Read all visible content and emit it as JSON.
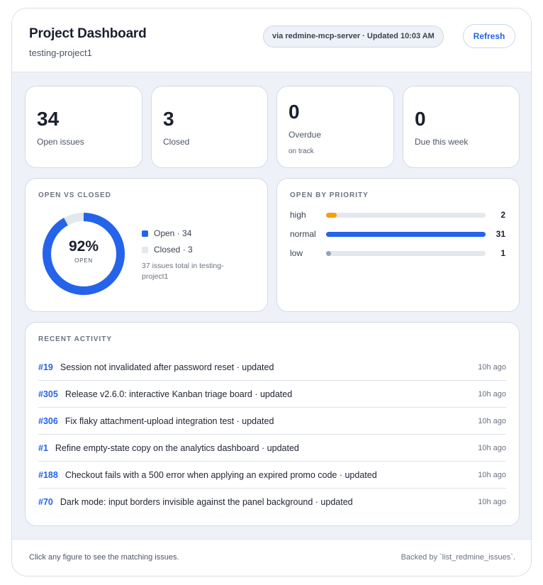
{
  "header": {
    "title": "Project Dashboard",
    "project": "testing-project1",
    "source_badge": "via redmine-mcp-server · Updated 10:03 AM",
    "refresh_label": "Refresh"
  },
  "stats": [
    {
      "value": "34",
      "label": "Open issues",
      "sub": ""
    },
    {
      "value": "3",
      "label": "Closed",
      "sub": ""
    },
    {
      "value": "0",
      "label": "Overdue",
      "sub": "on track"
    },
    {
      "value": "0",
      "label": "Due this week",
      "sub": ""
    }
  ],
  "open_vs_closed": {
    "section_label": "OPEN VS CLOSED",
    "percent": "92%",
    "caption": "OPEN",
    "open_fraction": 0.919,
    "legend": [
      {
        "label": "Open · 34",
        "color": "#2563eb"
      },
      {
        "label": "Closed · 3",
        "color": "#e3e7ee"
      }
    ],
    "note": "37 issues total in testing-project1"
  },
  "open_by_priority": {
    "section_label": "OPEN BY PRIORITY",
    "max": 31,
    "rows": [
      {
        "label": "high",
        "count": "2",
        "value": 2,
        "color": "#f59e0b"
      },
      {
        "label": "normal",
        "count": "31",
        "value": 31,
        "color": "#2563eb"
      },
      {
        "label": "low",
        "count": "1",
        "value": 1,
        "color": "#94a3b8"
      }
    ]
  },
  "recent_activity": {
    "section_label": "RECENT ACTIVITY",
    "items": [
      {
        "id": "#19",
        "text": "Session not invalidated after password reset · updated",
        "time": "10h ago"
      },
      {
        "id": "#305",
        "text": "Release v2.6.0: interactive Kanban triage board · updated",
        "time": "10h ago"
      },
      {
        "id": "#306",
        "text": "Fix flaky attachment-upload integration test · updated",
        "time": "10h ago"
      },
      {
        "id": "#1",
        "text": "Refine empty-state copy on the analytics dashboard · updated",
        "time": "10h ago"
      },
      {
        "id": "#188",
        "text": "Checkout fails with a 500 error when applying an expired promo code · updated",
        "time": "10h ago"
      },
      {
        "id": "#70",
        "text": "Dark mode: input borders invisible against the panel background · updated",
        "time": "10h ago"
      }
    ]
  },
  "footer": {
    "hint": "Click any figure to see the matching issues.",
    "backed_by": "Backed by `list_redmine_issues`."
  }
}
